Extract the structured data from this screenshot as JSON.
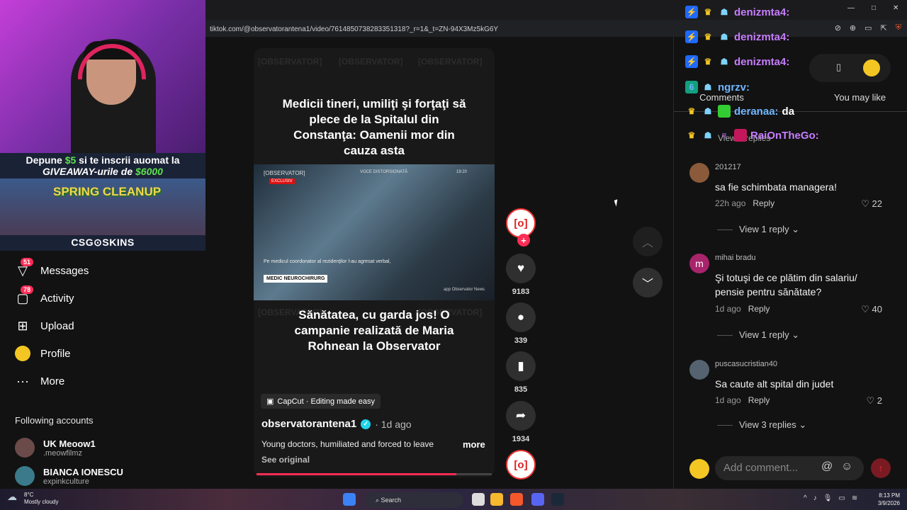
{
  "browser": {
    "url": "tiktok.com/@observatorantena1/video/7614850738283351318?_r=1&_t=ZN-94X3Mz5kG6Y"
  },
  "stream": {
    "promo_line1_prefix": "Depune ",
    "promo_amount1": "$5",
    "promo_line1_suffix": " si te inscrii auomat la",
    "promo_line2_prefix": "GIVEAWAY-urile de ",
    "promo_amount2": "$6000",
    "banner_text": "SPRING CLEANUP",
    "brand": "CSG⊙SKINS"
  },
  "nav": {
    "items": [
      {
        "label": "Messages",
        "badge": "51",
        "icon": "messages-icon"
      },
      {
        "label": "Activity",
        "badge": "78",
        "icon": "activity-icon"
      },
      {
        "label": "Upload",
        "icon": "upload-icon"
      },
      {
        "label": "Profile",
        "icon": "profile-icon"
      },
      {
        "label": "More",
        "icon": "more-icon"
      }
    ],
    "following_title": "Following accounts",
    "accounts": [
      {
        "name": "UK Meoow1",
        "handle": ".meowfilmz"
      },
      {
        "name": "BIANCA IONESCU",
        "handle": "expinkculture"
      }
    ]
  },
  "video": {
    "watermark": "[OBSERVATOR]",
    "headline1": "Medicii tineri, umiliţi şi forţaţi să plece de la Spitalul din Constanţa: Oamenii mor din cauza asta",
    "scene_logo": "[OBSERVATOR]",
    "scene_exclusive": "EXCLUSIV",
    "scene_voice": "VOCE DISTORSIONATĂ",
    "scene_time": "19:20",
    "scene_caption": "Pe medicul coordonator al rezidenţilor l-au agresat verbal,",
    "scene_tag": "MEDIC NEUROCHIRURG",
    "scene_app": "app Observator News",
    "headline2": "Sănătatea, cu garda jos! O campanie realizată de Maria Rohnean la Observator",
    "capcut": "CapCut · Editing made easy",
    "author": "observatorantena1",
    "ago": "· 1d ago",
    "description": "Young doctors, humiliated and forced to leave",
    "more": "more",
    "see_original": "See original",
    "progress": 0.85
  },
  "actions": {
    "likes": "9183",
    "comments": "339",
    "saves": "835",
    "shares": "1934"
  },
  "comments_panel": {
    "tabs": [
      "Comments",
      "You may like"
    ],
    "partial_view_replies": "View 4 replies",
    "comments": [
      {
        "user": "201217",
        "text": "sa fie schimbata managera!",
        "ago": "22h ago",
        "reply": "Reply",
        "likes": "22",
        "view_replies": "View 1 reply",
        "color": "#8a5a3a"
      },
      {
        "user": "mihai bradu",
        "text": "Şi totuşi de ce plătim din salariu/ pensie pentru sănătate?",
        "ago": "1d ago",
        "reply": "Reply",
        "likes": "40",
        "view_replies": "View 1 reply",
        "color": "#a8246b",
        "initial": "m"
      },
      {
        "user": "puscasucristian40",
        "text": "Sa caute alt spital din judet",
        "ago": "1d ago",
        "reply": "Reply",
        "likes": "2",
        "view_replies": "View 3 replies",
        "color": "#556270"
      }
    ],
    "add_placeholder": "Add comment..."
  },
  "chat": {
    "lines": [
      {
        "user": "denizmta4:",
        "msg": ""
      },
      {
        "user": "denizmta4:",
        "msg": ""
      },
      {
        "user": "denizmta4:",
        "msg": ""
      },
      {
        "user": "ngrzv:",
        "msg": ""
      },
      {
        "user": "deranaa:",
        "msg": "da"
      },
      {
        "user": "RaiOnTheGo:",
        "msg": ""
      }
    ]
  },
  "taskbar": {
    "temp": "8°C",
    "weather": "Mostly cloudy",
    "search": "Search",
    "time": "8:13 PM",
    "date": "3/9/2026"
  }
}
